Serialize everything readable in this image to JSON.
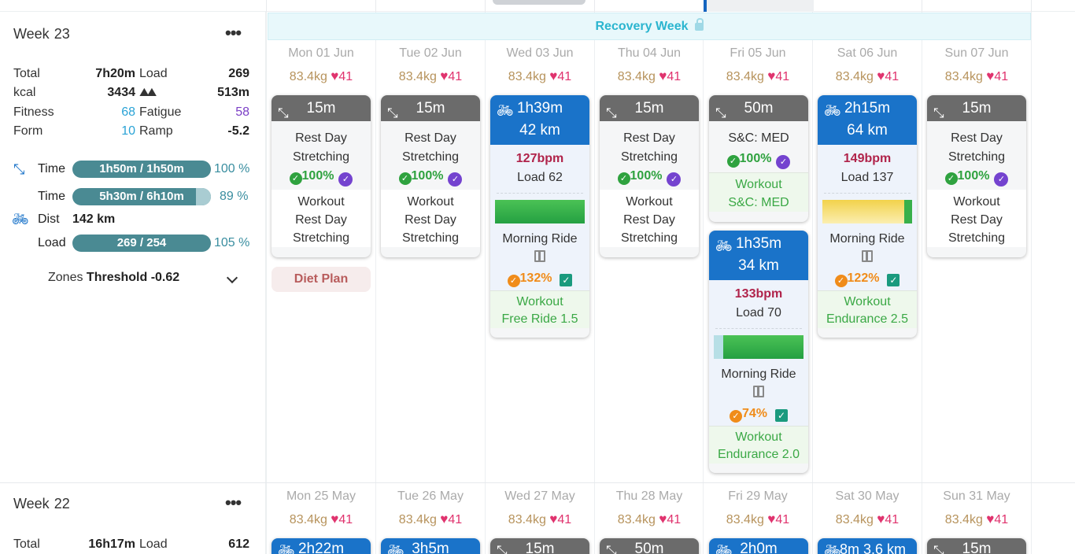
{
  "week23": {
    "title": "Week",
    "num": "23",
    "more": "•••",
    "stats": {
      "total_label": "Total",
      "total": "7h20m",
      "load_label": "Load",
      "load": "269",
      "kcal_label": "kcal",
      "kcal": "3434",
      "elev": "513m",
      "fitness_label": "Fitness",
      "fitness": "68",
      "fatigue_label": "Fatigue",
      "fatigue": "58",
      "form_label": "Form",
      "form": "10",
      "ramp_label": "Ramp",
      "ramp": "-5.2"
    },
    "targets": {
      "stretch_time_label": "Time",
      "stretch_time": "1h50m / 1h50m",
      "stretch_time_pct": "100 %",
      "stretch_time_fill": 1.0,
      "ride_time_label": "Time",
      "ride_time": "5h30m / 6h10m",
      "ride_time_pct": "89 %",
      "ride_time_fill": 0.89,
      "dist_label": "Dist",
      "dist": "142 km",
      "load_label": "Load",
      "load": "269 / 254",
      "load_pct": "105 %",
      "load_fill": 1.0
    },
    "zones_label": "Zones",
    "zones_value": "Threshold -0.62",
    "recovery": "Recovery Week",
    "days": [
      {
        "head": "Mon 01 Jun",
        "kg": "83.4kg",
        "hr": "41"
      },
      {
        "head": "Tue 02 Jun",
        "kg": "83.4kg",
        "hr": "41"
      },
      {
        "head": "Wed 03 Jun",
        "kg": "83.4kg",
        "hr": "41"
      },
      {
        "head": "Thu 04 Jun",
        "kg": "83.4kg",
        "hr": "41"
      },
      {
        "head": "Fri 05 Jun",
        "kg": "83.4kg",
        "hr": "41"
      },
      {
        "head": "Sat 06 Jun",
        "kg": "83.4kg",
        "hr": "41"
      },
      {
        "head": "Sun 07 Jun",
        "kg": "83.4kg",
        "hr": "41"
      }
    ],
    "stretch": {
      "dur": "15m",
      "l1": "Rest Day",
      "l2": "Stretching",
      "pct": "100%",
      "w1": "Workout",
      "w2": "Rest Day",
      "w3": "Stretching"
    },
    "diet": "Diet Plan",
    "wed": {
      "dur": "1h39m",
      "dist": "42 km",
      "bpm": "127bpm",
      "load": "Load 62",
      "name": "Morning Ride",
      "pct": "132%",
      "w1": "Workout",
      "w2": "Free Ride 1.5"
    },
    "fri_sc": {
      "dur": "50m",
      "title": "S&C: MED",
      "pct": "100%",
      "w1": "Workout",
      "w2": "S&C: MED"
    },
    "fri_ride": {
      "dur": "1h35m",
      "dist": "34 km",
      "bpm": "133bpm",
      "load": "Load 70",
      "name": "Morning Ride",
      "pct": "74%",
      "w1": "Workout",
      "w2": "Endurance 2.0"
    },
    "sat": {
      "dur": "2h15m",
      "dist": "64 km",
      "bpm": "149bpm",
      "load": "Load 137",
      "name": "Morning Ride",
      "pct": "122%",
      "w1": "Workout",
      "w2": "Endurance 2.5"
    }
  },
  "week22": {
    "title": "Week",
    "num": "22",
    "more": "•••",
    "total_label": "Total",
    "total": "16h17m",
    "load_label": "Load",
    "load": "612",
    "days": [
      {
        "head": "Mon 25 May",
        "kg": "83.4kg",
        "hr": "41",
        "card": "2h22m"
      },
      {
        "head": "Tue 26 May",
        "kg": "83.4kg",
        "hr": "41",
        "card": "3h5m"
      },
      {
        "head": "Wed 27 May",
        "kg": "83.4kg",
        "hr": "41",
        "card": "15m"
      },
      {
        "head": "Thu 28 May",
        "kg": "83.4kg",
        "hr": "41",
        "card": "50m"
      },
      {
        "head": "Fri 29 May",
        "kg": "83.4kg",
        "hr": "41",
        "card": "2h0m"
      },
      {
        "head": "Sat 30 May",
        "kg": "83.4kg",
        "hr": "41",
        "card": "8m 3.6 km"
      },
      {
        "head": "Sun 31 May",
        "kg": "83.4kg",
        "hr": "41",
        "card": "15m"
      }
    ]
  },
  "colors": {
    "ride": "#1a73c9",
    "stretch": "#6b6b6b",
    "pill": "#4a8a93",
    "accent": "#2bb5cf"
  }
}
